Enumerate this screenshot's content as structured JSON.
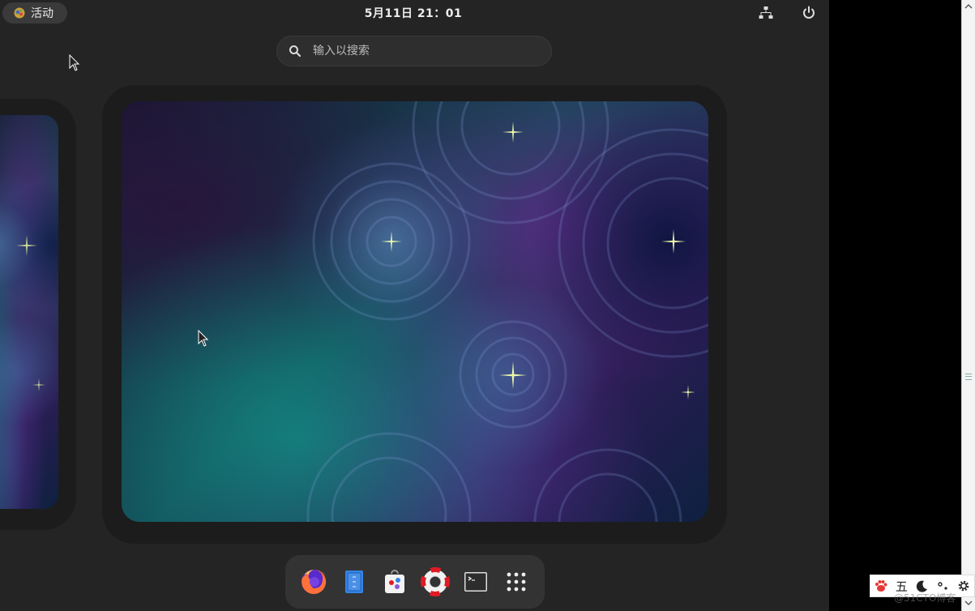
{
  "topbar": {
    "activities_label": "活动",
    "clock": "5月11日  21：01",
    "network_icon": "network-wired-icon",
    "power_icon": "power-icon"
  },
  "search": {
    "placeholder": "输入以搜索",
    "icon": "search-icon"
  },
  "dash": {
    "items": [
      {
        "name": "firefox",
        "icon": "firefox-icon"
      },
      {
        "name": "text-editor",
        "icon": "text-editor-icon"
      },
      {
        "name": "software",
        "icon": "software-store-icon"
      },
      {
        "name": "help",
        "icon": "help-lifebuoy-icon"
      },
      {
        "name": "terminal",
        "icon": "terminal-icon"
      },
      {
        "name": "show-apps",
        "icon": "app-grid-icon"
      }
    ]
  },
  "ime": {
    "mode_label": "五",
    "icons": [
      "baidu-paw-icon",
      "moon-icon",
      "punctuation-icon",
      "settings-gear-icon"
    ]
  },
  "watermark": "@51CTO博客",
  "colors": {
    "panel": "#242424",
    "workspace_frame": "#1c1c1c",
    "dash": "#333333",
    "accent_teal": "#1e9a90",
    "accent_purple": "#5a2a8a"
  }
}
